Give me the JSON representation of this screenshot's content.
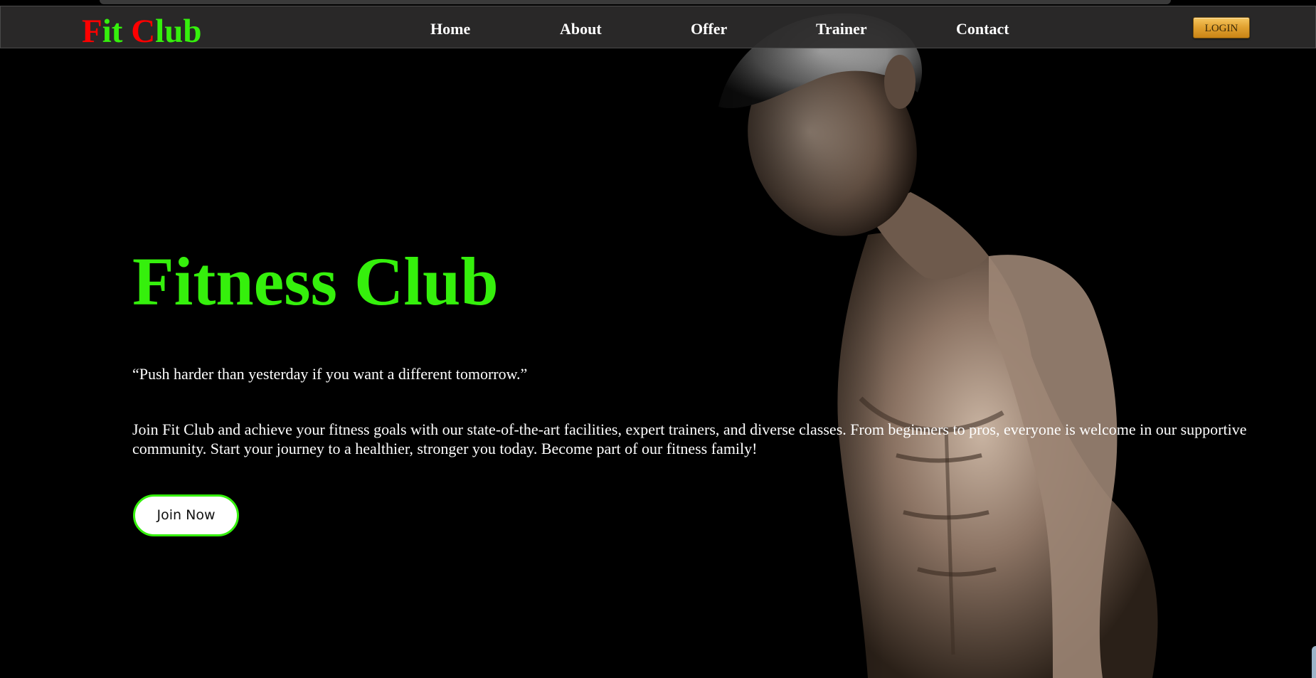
{
  "header": {
    "brand_first_initial": "F",
    "brand_first_rest": "it ",
    "brand_second_initial": "C",
    "brand_second_rest": "lub",
    "nav": [
      {
        "label": "Home"
      },
      {
        "label": "About"
      },
      {
        "label": "Offer"
      },
      {
        "label": "Trainer"
      },
      {
        "label": "Contact"
      }
    ],
    "login_label": "LOGIN"
  },
  "hero": {
    "title": "Fitness Club",
    "quote": "“Push harder than yesterday if you want a different tomorrow.”",
    "description": "Join Fit Club and achieve your fitness goals with our state-of-the-art facilities, expert trainers, and diverse classes. From beginners to pros, everyone is welcome in our supportive community. Start your journey to a healthier, stronger you today. Become part of our fitness family!",
    "cta_label": "Join Now",
    "image": "shirtless-athlete-photo"
  },
  "colors": {
    "accent_green": "#35f00c",
    "brand_red": "#ff0000",
    "nav_bg": "#2c2b2b",
    "login_gold": "#e2a332",
    "background": "#000000"
  }
}
